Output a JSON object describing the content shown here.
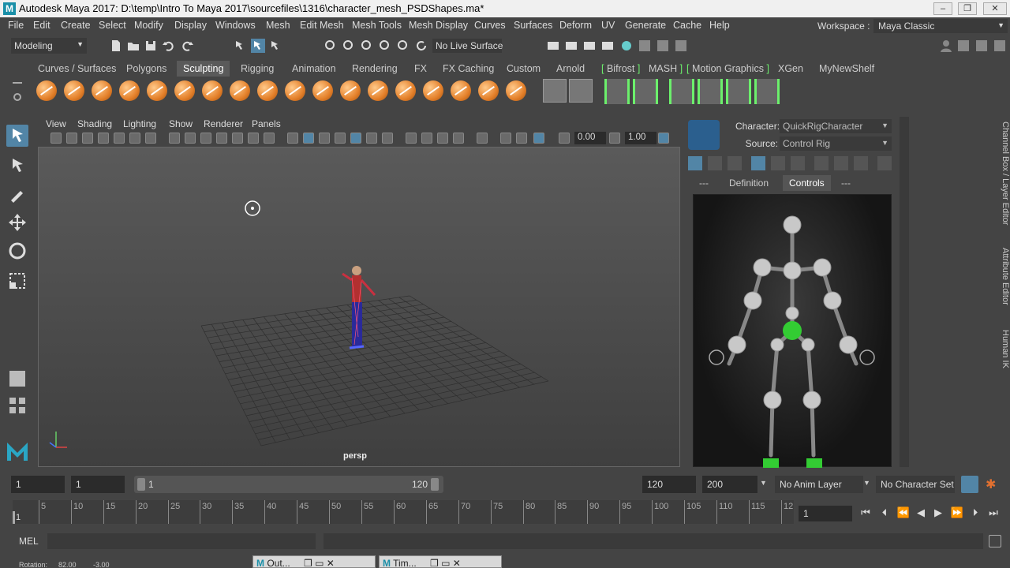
{
  "window": {
    "title": "Autodesk Maya 2017: D:\\temp\\Intro To Maya 2017\\sourcefiles\\1316\\character_mesh_PSDShapes.ma*",
    "app_icon": "M"
  },
  "menubar": {
    "items": [
      "File",
      "Edit",
      "Create",
      "Select",
      "Modify",
      "Display",
      "Windows",
      "Mesh",
      "Edit Mesh",
      "Mesh Tools",
      "Mesh Display",
      "Curves",
      "Surfaces",
      "Deform",
      "UV",
      "Generate",
      "Cache",
      "Help"
    ],
    "workspace_label": "Workspace :",
    "workspace_value": "Maya Classic"
  },
  "statusline": {
    "mode": "Modeling",
    "live_surface": "No Live Surface"
  },
  "shelf": {
    "tabs": [
      "Curves / Surfaces",
      "Polygons",
      "Sculpting",
      "Rigging",
      "Animation",
      "Rendering",
      "FX",
      "FX Caching",
      "Custom",
      "Arnold",
      "Bifrost",
      "MASH",
      "Motion Graphics",
      "XGen",
      "MyNewShelf"
    ],
    "active_tab": "Sculpting"
  },
  "viewport": {
    "menus": [
      "View",
      "Shading",
      "Lighting",
      "Show",
      "Renderer",
      "Panels"
    ],
    "near_value": "0.00",
    "far_value": "1.00",
    "camera_label": "persp"
  },
  "hik": {
    "character_label": "Character:",
    "character_value": "QuickRigCharacter",
    "source_label": "Source:",
    "source_value": "Control Rig",
    "tabs": [
      "---",
      "Definition",
      "Controls",
      "---"
    ],
    "active_tab": "Controls"
  },
  "side_tabs": [
    "Channel Box / Layer Editor",
    "Attribute Editor",
    "Human IK"
  ],
  "range": {
    "start_field": "1",
    "playback_start": "1",
    "slider_start": "1",
    "slider_end": "120",
    "playback_end": "120",
    "end_field": "200",
    "anim_layer": "No Anim Layer",
    "character_set": "No Character Set"
  },
  "timeline": {
    "ticks": [
      "5",
      "10",
      "15",
      "20",
      "25",
      "30",
      "35",
      "40",
      "45",
      "50",
      "55",
      "60",
      "65",
      "70",
      "75",
      "80",
      "85",
      "90",
      "95",
      "100",
      "105",
      "110",
      "115",
      "12"
    ],
    "current_frame": "1",
    "frame_field": "1"
  },
  "cmdline": {
    "label": "MEL"
  },
  "helpline": {
    "label": "Rotation:",
    "value_x": "82.00",
    "value_y": "-3.00"
  },
  "taskbar": {
    "outliner": "Out...",
    "timeslider": "Tim..."
  },
  "colors": {
    "accent_blue": "#5285a6",
    "shelf_bracket_green": "#6cf06c",
    "hik_active_joint": "#33cc33",
    "orange_shelf": "#e4802a"
  }
}
